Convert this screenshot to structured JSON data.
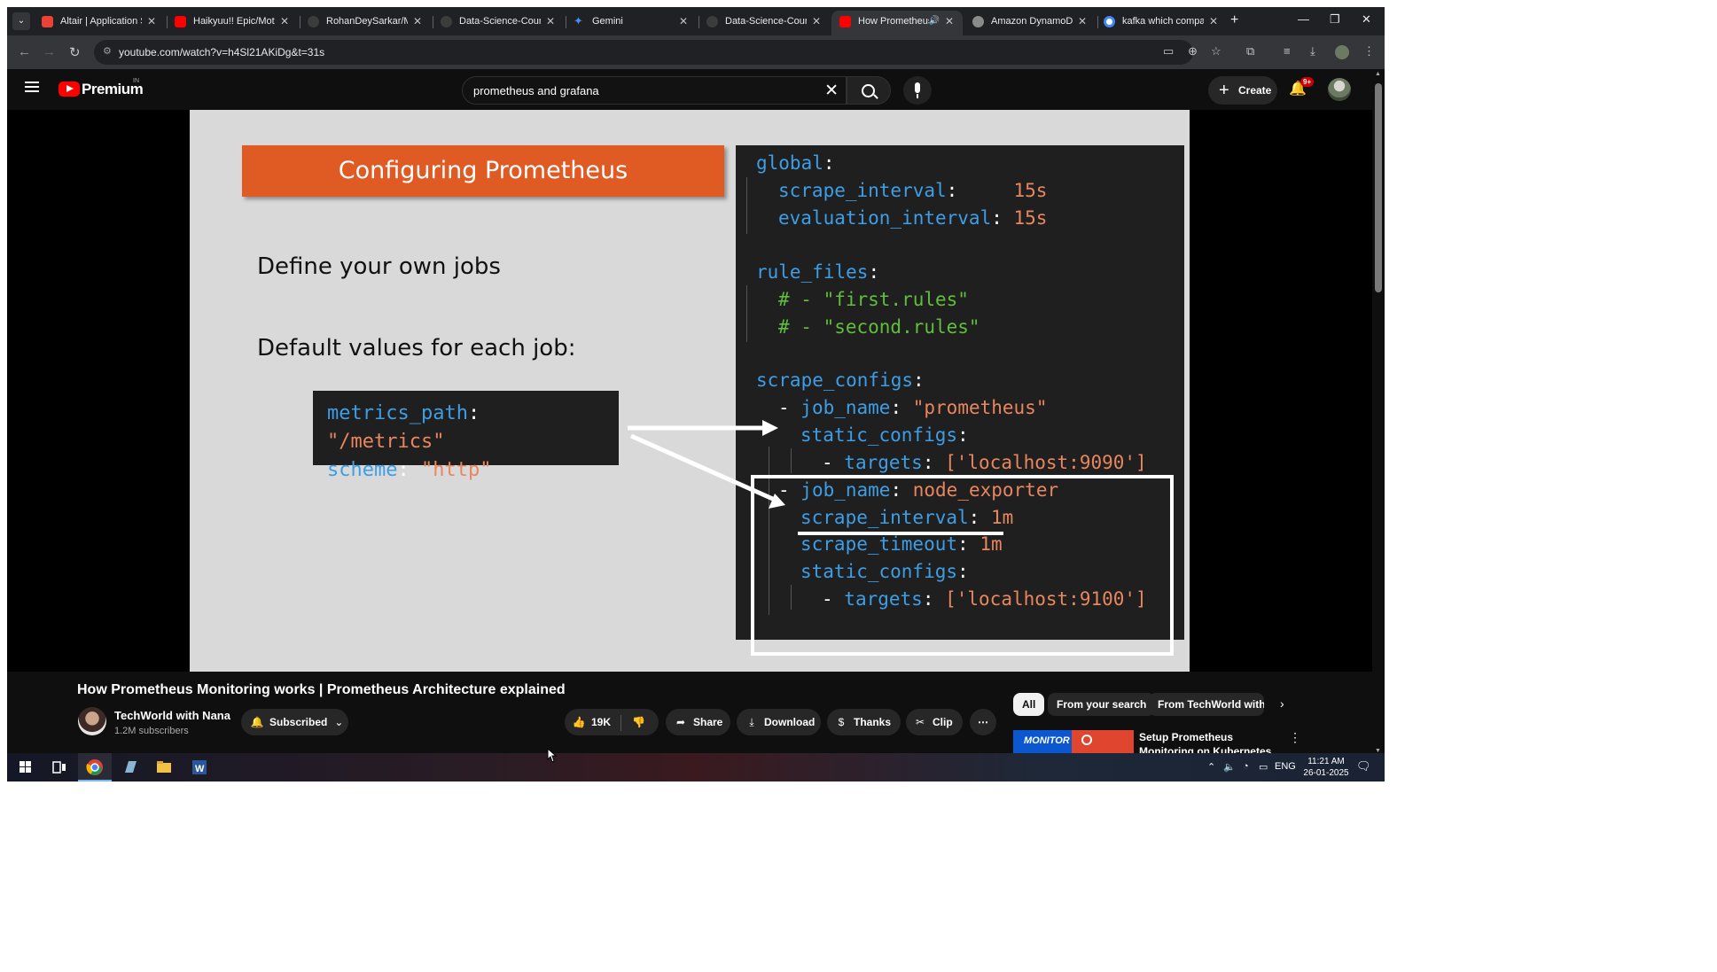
{
  "browser": {
    "tabs": [
      {
        "title": "Altair | Application St",
        "fav_color": "#ea4335"
      },
      {
        "title": "Haikyuu!! Epic/Motiv",
        "fav_color": "#ff0000"
      },
      {
        "title": "RohanDeySarkar/Mis",
        "fav_color": "#3c3c3c"
      },
      {
        "title": "Data-Science-Course",
        "fav_color": "#3c3c3c"
      },
      {
        "title": "Gemini",
        "fav_color": "#4a8af4"
      },
      {
        "title": "Data-Science-Course",
        "fav_color": "#3c3c3c"
      },
      {
        "title": "How Prometheus",
        "fav_color": "#ff0000"
      },
      {
        "title": "Amazon DynamoDB",
        "fav_color": "#8a8a8a"
      },
      {
        "title": "kafka which company",
        "fav_color": "#4285f4"
      }
    ],
    "active_tab": 6,
    "url": "youtube.com/watch?v=h4Sl21AKiDg&t=31s"
  },
  "youtube": {
    "logo_text": "Premium",
    "country_code": "IN",
    "search_query": "prometheus and grafana",
    "create_label": "Create",
    "notification_badge": "9+"
  },
  "slide": {
    "title": "Configuring Prometheus",
    "bullet1": "Define your own jobs",
    "bullet2": "Default values for each job:",
    "defaults": {
      "metrics_path_key": "metrics_path",
      "metrics_path_val": "\"/metrics\"",
      "scheme_key": "scheme",
      "scheme_val": "\"http\""
    },
    "code": {
      "global": "global",
      "scrape_interval_key": "scrape_interval",
      "scrape_interval_val": "15s",
      "evaluation_interval_key": "evaluation_interval",
      "evaluation_interval_val": "15s",
      "rule_files": "rule_files",
      "comment1": "# - \"first.rules\"",
      "comment2": "# - \"second.rules\"",
      "scrape_configs": "scrape_configs",
      "job1_key": "job_name",
      "job1_val": "\"prometheus\"",
      "static_configs": "static_configs",
      "targets_key": "targets",
      "targets1_val": "['localhost:9090']",
      "job2_key": "job_name",
      "job2_val": "node_exporter",
      "job2_interval_key": "scrape_interval",
      "job2_interval_val": "1m",
      "job2_timeout_key": "scrape_timeout",
      "job2_timeout_val": "1m",
      "targets2_val": "['localhost:9100']"
    }
  },
  "video": {
    "title": "How Prometheus Monitoring works | Prometheus Architecture explained",
    "channel": "TechWorld with Nana",
    "subscribers": "1.2M subscribers",
    "subscribed_label": "Subscribed",
    "likes": "19K",
    "share_label": "Share",
    "download_label": "Download",
    "thanks_label": "Thanks",
    "clip_label": "Clip"
  },
  "recommendations": {
    "chips": [
      "All",
      "From your search",
      "From TechWorld with N"
    ],
    "first_title": "Setup Prometheus Monitoring on Kubernetes using Helm and",
    "first_thumb_label": "MONITOR"
  },
  "taskbar": {
    "language": "ENG",
    "time": "11:21 AM",
    "date": "26-01-2025"
  }
}
